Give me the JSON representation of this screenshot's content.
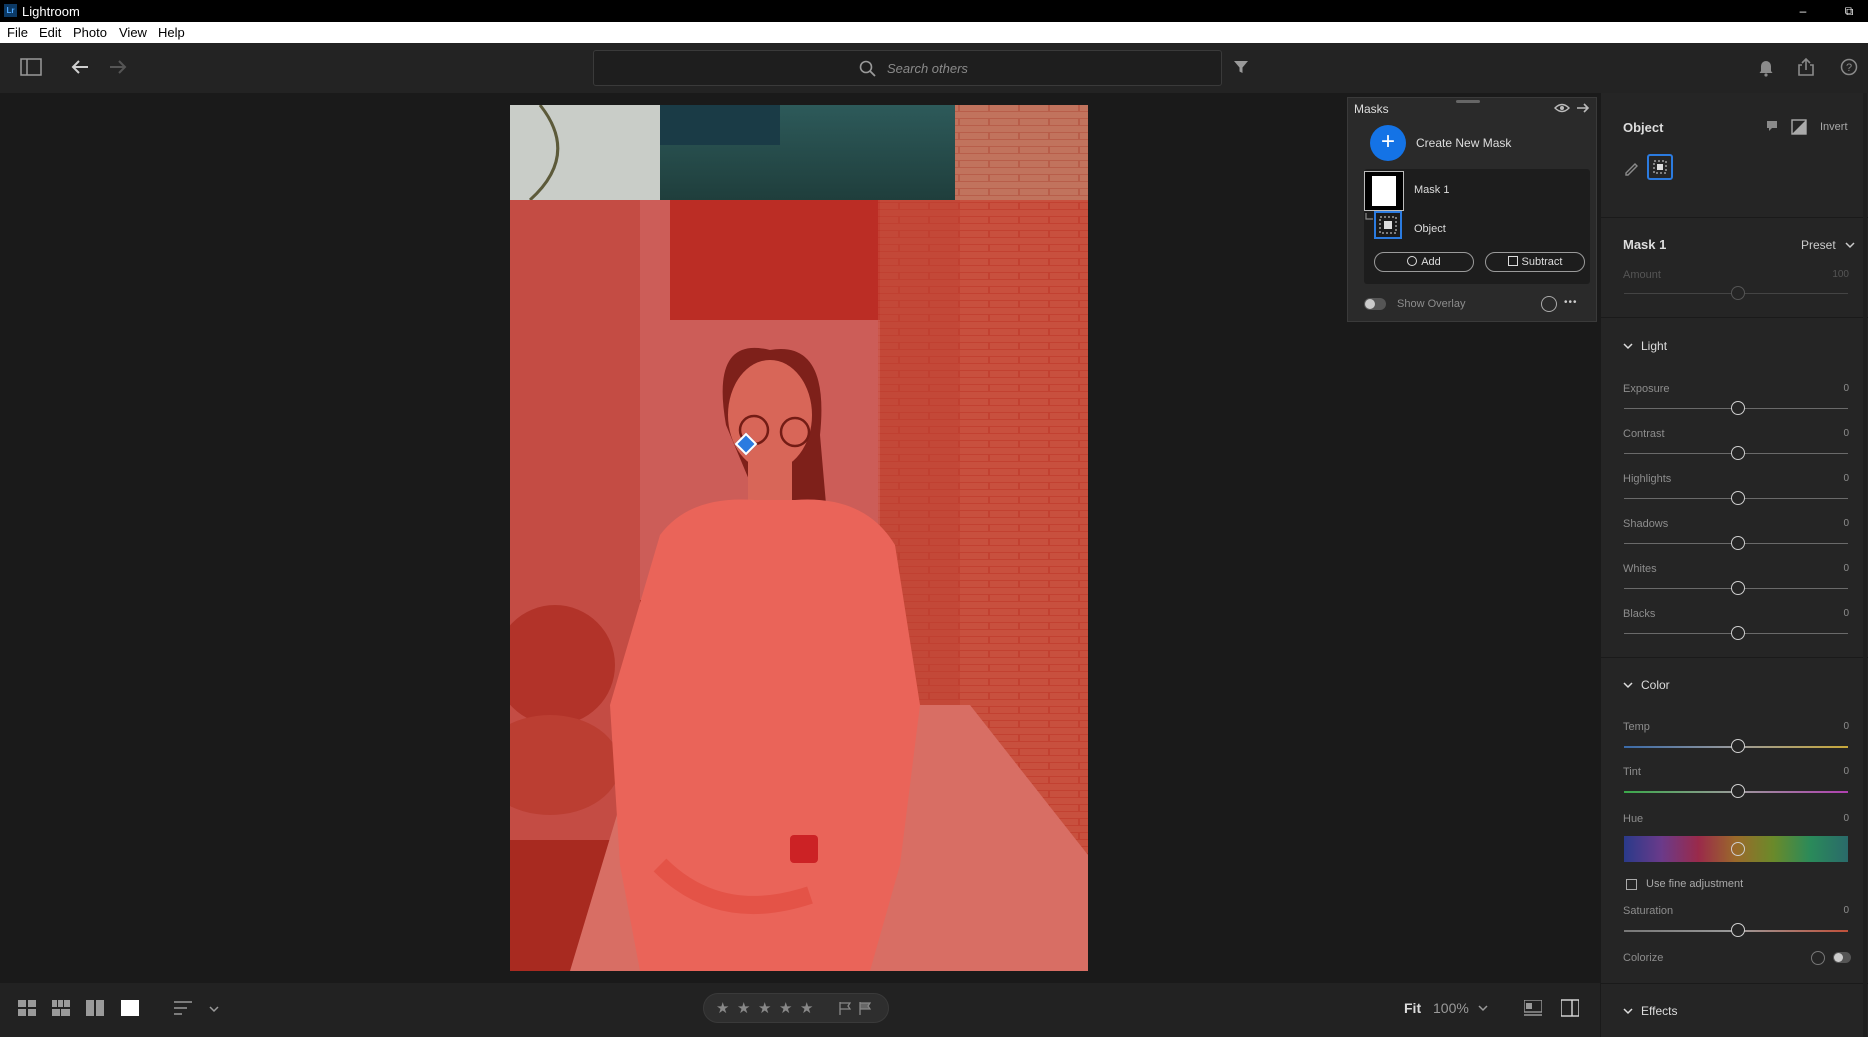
{
  "app": {
    "title": "Lightroom",
    "logo": "Lr"
  },
  "window_controls": {
    "minimize": "–",
    "restore": "⧉"
  },
  "menu": [
    "File",
    "Edit",
    "Photo",
    "View",
    "Help"
  ],
  "search": {
    "placeholder": "Search others"
  },
  "masks_panel": {
    "title": "Masks",
    "create_label": "Create New Mask",
    "mask_name": "Mask 1",
    "component_name": "Object",
    "add_label": "Add",
    "subtract_label": "Subtract",
    "show_overlay_label": "Show Overlay",
    "more_label": "•••"
  },
  "right_panel": {
    "object_title": "Object",
    "invert_label": "Invert",
    "mask_title": "Mask 1",
    "preset_label": "Preset",
    "amount_label": "Amount",
    "amount_value": "100",
    "light": {
      "title": "Light",
      "sliders": [
        {
          "label": "Exposure",
          "value": "0"
        },
        {
          "label": "Contrast",
          "value": "0"
        },
        {
          "label": "Highlights",
          "value": "0"
        },
        {
          "label": "Shadows",
          "value": "0"
        },
        {
          "label": "Whites",
          "value": "0"
        },
        {
          "label": "Blacks",
          "value": "0"
        }
      ]
    },
    "color": {
      "title": "Color",
      "temp_label": "Temp",
      "temp_value": "0",
      "tint_label": "Tint",
      "tint_value": "0",
      "hue_label": "Hue",
      "hue_value": "0",
      "fine_adjust_label": "Use fine adjustment",
      "saturation_label": "Saturation",
      "saturation_value": "0",
      "colorize_label": "Colorize"
    },
    "effects": {
      "title": "Effects"
    }
  },
  "bottom_bar": {
    "fit_label": "Fit",
    "zoom_value": "100%",
    "stars": [
      "★",
      "★",
      "★",
      "★",
      "★"
    ]
  },
  "colors": {
    "accent": "#1473e6",
    "mask_overlay": "#e0281e",
    "panel_bg": "#252525"
  }
}
